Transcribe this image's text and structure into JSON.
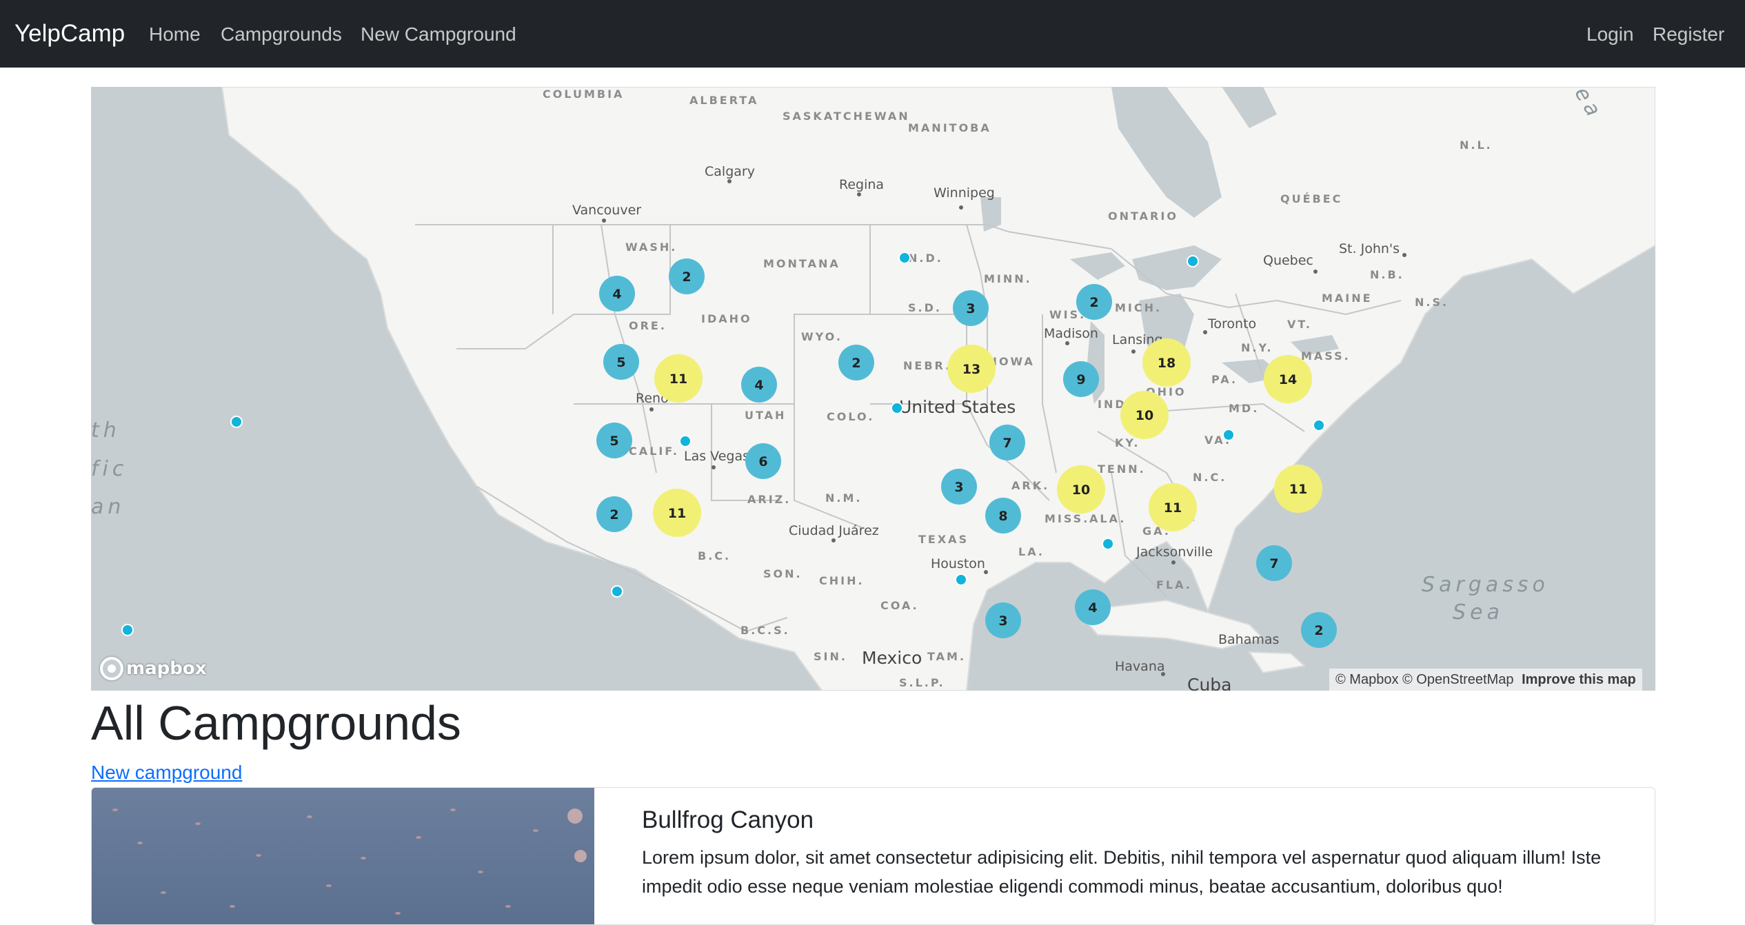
{
  "navbar": {
    "brand": "YelpCamp",
    "links": [
      {
        "label": "Home"
      },
      {
        "label": "Campgrounds"
      },
      {
        "label": "New Campground"
      }
    ],
    "auth": [
      {
        "label": "Login"
      },
      {
        "label": "Register"
      }
    ],
    "background": "#212529"
  },
  "map": {
    "zoom_in_icon": "plus-icon",
    "zoom_out_icon": "minus-icon",
    "compass_icon": "compass-icon",
    "logo": "mapbox",
    "attribution": {
      "mapbox": "© Mapbox",
      "osm": "© OpenStreetMap",
      "improve": "Improve this map"
    },
    "labels": {
      "columbia": "COLUMBIA",
      "alberta": "ALBERTA",
      "saskatchewan": "SASKATCHEWAN",
      "manitoba": "MANITOBA",
      "calgary": "Calgary",
      "regina": "Regina",
      "winnipeg": "Winnipeg",
      "vancouver": "Vancouver",
      "ontario": "ONTARIO",
      "quebec_prov": "QUÉBEC",
      "nl": "N.L.",
      "quebec_city": "Quebec",
      "st_johns": "St. John's",
      "nb": "N.B.",
      "ns": "N.S.",
      "maine": "MAINE",
      "vt": "VT.",
      "mass": "MASS.",
      "wash": "WASH.",
      "montana": "MONTANA",
      "nd": "N.D.",
      "minn": "MINN.",
      "sd": "S.D.",
      "wis": "WIS.",
      "mich": "MICH.",
      "toronto": "Toronto",
      "ore": "ORE.",
      "idaho": "IDAHO",
      "wyo": "WYO.",
      "madison": "Madison",
      "lansing": "Lansing",
      "ny": "N.Y.",
      "nebr": "NEBR.",
      "iowa": "IOWA",
      "pa": "PA.",
      "ohio": "OHIO",
      "reno": "Reno",
      "utah": "UTAH",
      "colo": "COLO.",
      "united_states": "United States",
      "ind": "IND.",
      "md": "MD.",
      "calif": "CALIF.",
      "las_vegas": "Las Vegas",
      "ky": "KY.",
      "va": "VA.",
      "ariz": "ARIZ.",
      "nm": "N.M.",
      "ark": "ARK.",
      "tenn": "TENN.",
      "nc": "N.C.",
      "ciudad_juarez": "Ciudad Juárez",
      "miss": "MISS.",
      "ala": "ALA.",
      "ga": "GA.",
      "texas": "TEXAS",
      "jacksonville": "Jacksonville",
      "bc": "B.C.",
      "son": "SON.",
      "chih": "CHIH.",
      "houston": "Houston",
      "la": "LA.",
      "fla": "FLA.",
      "sargasso": "Sargasso",
      "sea": "Sea",
      "coa": "COA.",
      "bcs": "B.C.S.",
      "bahamas": "Bahamas",
      "sin": "SIN.",
      "mexico": "Mexico",
      "tam": "TAM.",
      "slp": "S.L.P.",
      "havana": "Havana",
      "cuba": "Cuba",
      "pacific1": "th",
      "pacific2": "fic",
      "pacific3": "an",
      "sea_fragment": "ea"
    },
    "clusters": [
      {
        "count": "4",
        "level": "small"
      },
      {
        "count": "2",
        "level": "small"
      },
      {
        "count": "3",
        "level": "small"
      },
      {
        "count": "2",
        "level": "small"
      },
      {
        "count": "5",
        "level": "small"
      },
      {
        "count": "11",
        "level": "large"
      },
      {
        "count": "4",
        "level": "small"
      },
      {
        "count": "2",
        "level": "small"
      },
      {
        "count": "13",
        "level": "large"
      },
      {
        "count": "9",
        "level": "small"
      },
      {
        "count": "18",
        "level": "large"
      },
      {
        "count": "14",
        "level": "large"
      },
      {
        "count": "5",
        "level": "small"
      },
      {
        "count": "6",
        "level": "small"
      },
      {
        "count": "7",
        "level": "small"
      },
      {
        "count": "10",
        "level": "large"
      },
      {
        "count": "2",
        "level": "small"
      },
      {
        "count": "11",
        "level": "large"
      },
      {
        "count": "3",
        "level": "small"
      },
      {
        "count": "8",
        "level": "small"
      },
      {
        "count": "10",
        "level": "large"
      },
      {
        "count": "11",
        "level": "large"
      },
      {
        "count": "11",
        "level": "large"
      },
      {
        "count": "7",
        "level": "small"
      },
      {
        "count": "3",
        "level": "small"
      },
      {
        "count": "4",
        "level": "small"
      },
      {
        "count": "2",
        "level": "small"
      }
    ],
    "colors": {
      "small_cluster": "#51bbd6",
      "large_cluster": "#f1f075",
      "point": "#11b4da",
      "water": "#c7ced1",
      "land": "#f5f5f3"
    }
  },
  "main": {
    "title": "All Campgrounds",
    "new_link": "New campground",
    "campgrounds": [
      {
        "title": "Bullfrog Canyon",
        "description": "Lorem ipsum dolor, sit amet consectetur adipisicing elit. Debitis, nihil tempora vel aspernatur quod aliquam illum! Iste impedit odio esse neque veniam molestiae eligendi commodi minus, beatae accusantium, doloribus quo!"
      }
    ]
  }
}
